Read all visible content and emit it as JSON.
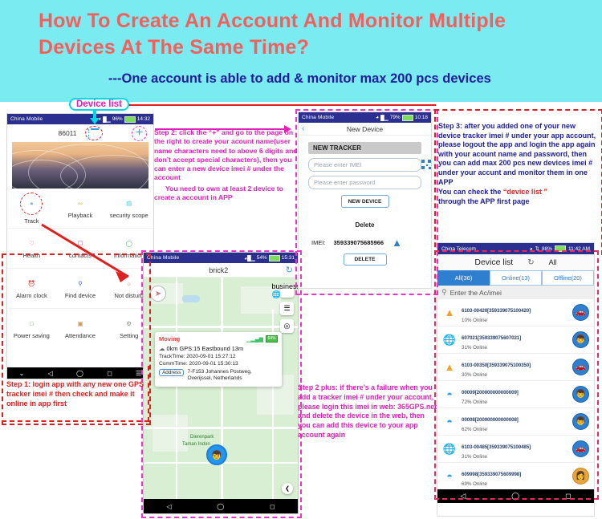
{
  "banner": {
    "title": "How To Create An Account And Monitor Multiple Devices At The Same Time?",
    "subtitle": "---One account is able to add & monitor max 200 pcs devices"
  },
  "callouts": {
    "device_list_label": "Device list",
    "step1": "Step 1: login app with any new one GPS tracker imei # then check and make it online in app first",
    "step2": "Step 2: click the “+” and go to the page on the right to create your acount name(user name characters need to above 6 digits and don’t accept special characters), then you can enter a new device imei # under the account",
    "step2_extra": "You need to own at least 2 device to create a account in APP",
    "step2_plus": "Step 2 plus: if there’s a failure when you add a tracker imei # under your account, please login this imei in web: 365GPS.net and delete the device in the web, then you can add this device to your app account again",
    "step3": "Step 3: after you added one of your new device tracker imei # under your app account, please logout the app and login the app again with your acount name and password, then you can add max 200 pcs new devices imei # under your accunt and monitor them in one APP",
    "step3_tail_pre": " You can check the ",
    "step3_tail_quoted": "“device list ”",
    "step3_tail_post": "through the APP first page"
  },
  "phone_home": {
    "status": {
      "carrier": "China Mobile",
      "battery": "96%",
      "time": "14:32"
    },
    "device_id": "86011",
    "list_icon": "list-icon",
    "add_icon": "plus-icon",
    "menu": [
      {
        "icon": "location-pin-icon",
        "label": "Track"
      },
      {
        "icon": "playback-route-icon",
        "label": "Playback"
      },
      {
        "icon": "fence-icon",
        "label": "security scope"
      },
      {
        "icon": "heart-icon",
        "label": "Health"
      },
      {
        "icon": "contacts-icon",
        "label": "contacts"
      },
      {
        "icon": "message-icon",
        "label": "Information"
      },
      {
        "icon": "alarm-clock-icon",
        "label": "Alarm clock"
      },
      {
        "icon": "magnifier-icon",
        "label": "Find device"
      },
      {
        "icon": "bell-off-icon",
        "label": "Not disturb"
      },
      {
        "icon": "battery-icon",
        "label": "Power saving"
      },
      {
        "icon": "attendance-icon",
        "label": "Attendance"
      },
      {
        "icon": "gear-icon",
        "label": "Setting"
      }
    ]
  },
  "phone_map": {
    "status": {
      "carrier": "China Mobile",
      "battery": "54%",
      "time": "15:31"
    },
    "title": "brick2",
    "back_icon": "back-chevron-icon",
    "refresh_icon": "refresh-icon",
    "card": {
      "state": "Moving",
      "battery": "64%",
      "summary": "0km GPS:15 Eastbound 13m",
      "track_time": "TrackTime: 2020-09-01 15:27:12",
      "comm_time": "CommTime: 2020-09-01 15:30:13",
      "address_label": "Address",
      "address_line1": "7-F153 Johannes Postweg,",
      "address_line2": "Overijssel, Netherlands"
    },
    "map_labels": [
      "Dierenpark",
      "Taman Indon"
    ],
    "side_buttons": [
      "layers-icon",
      "ruler-icon",
      "locate-icon"
    ],
    "share_icon": "share-icon"
  },
  "phone_new_device": {
    "status": {
      "carrier": "China Mobile",
      "battery": "79%",
      "time": "10:18"
    },
    "title": "New Device",
    "new_tracker_header": "NEW TRACKER",
    "imei_placeholder": "Please enter IMEI",
    "password_placeholder": "Please enter password",
    "qr_icon": "qr-code-icon",
    "new_device_button": "NEW DEVICE",
    "delete_section_title": "Delete",
    "imei_label": "IMEI:",
    "imei_value": "359339075685966",
    "nav_icon": "navigation-arrow-icon",
    "delete_button": "DELETE"
  },
  "phone_device_list": {
    "status": {
      "carrier": "China Telecom",
      "battery": "88%",
      "time": "11:42 AM"
    },
    "title": "Device list",
    "refresh_icon": "refresh-icon",
    "all_label": "All",
    "tabs": [
      {
        "label": "All(36)",
        "active": true
      },
      {
        "label": "Online(13)",
        "active": false
      },
      {
        "label": "Offline(20)",
        "active": false
      }
    ],
    "search_icon": "search-icon",
    "search_placeholder": "Enter the Ac/imei",
    "rows": [
      {
        "icon": "tower-icon",
        "name": "6103-00420[359339075100420]",
        "status": "10%  Online",
        "avatar": "car-avatar"
      },
      {
        "icon": "globe-pin-icon",
        "name": "607021[359339075607021]",
        "status": "31%  Online",
        "avatar": "boy-avatar"
      },
      {
        "icon": "tower-icon",
        "name": "6103-00350[359339075100350]",
        "status": "30%  Online",
        "avatar": "car-avatar"
      },
      {
        "icon": "wifi-icon",
        "name": "00009[200000000000009]",
        "status": "72%  Online",
        "avatar": "boy-avatar"
      },
      {
        "icon": "wifi-icon",
        "name": "00008[200000000000008]",
        "status": "62%  Online",
        "avatar": "boy-avatar"
      },
      {
        "icon": "globe-pin-icon",
        "name": "6103-00485[359339075100485]",
        "status": "31%  Online",
        "avatar": "car-avatar"
      },
      {
        "icon": "wifi-icon",
        "name": "609998[359339075609998]",
        "status": "69%  Online",
        "avatar": "girl-avatar"
      }
    ]
  },
  "colors": {
    "banner_bg": "#7bebf2",
    "title_red": "#f2605e",
    "subtitle_blue": "#1c1c9c",
    "magenta": "#e020b8",
    "red": "#e02020",
    "accent_blue": "#2f7fd0"
  }
}
